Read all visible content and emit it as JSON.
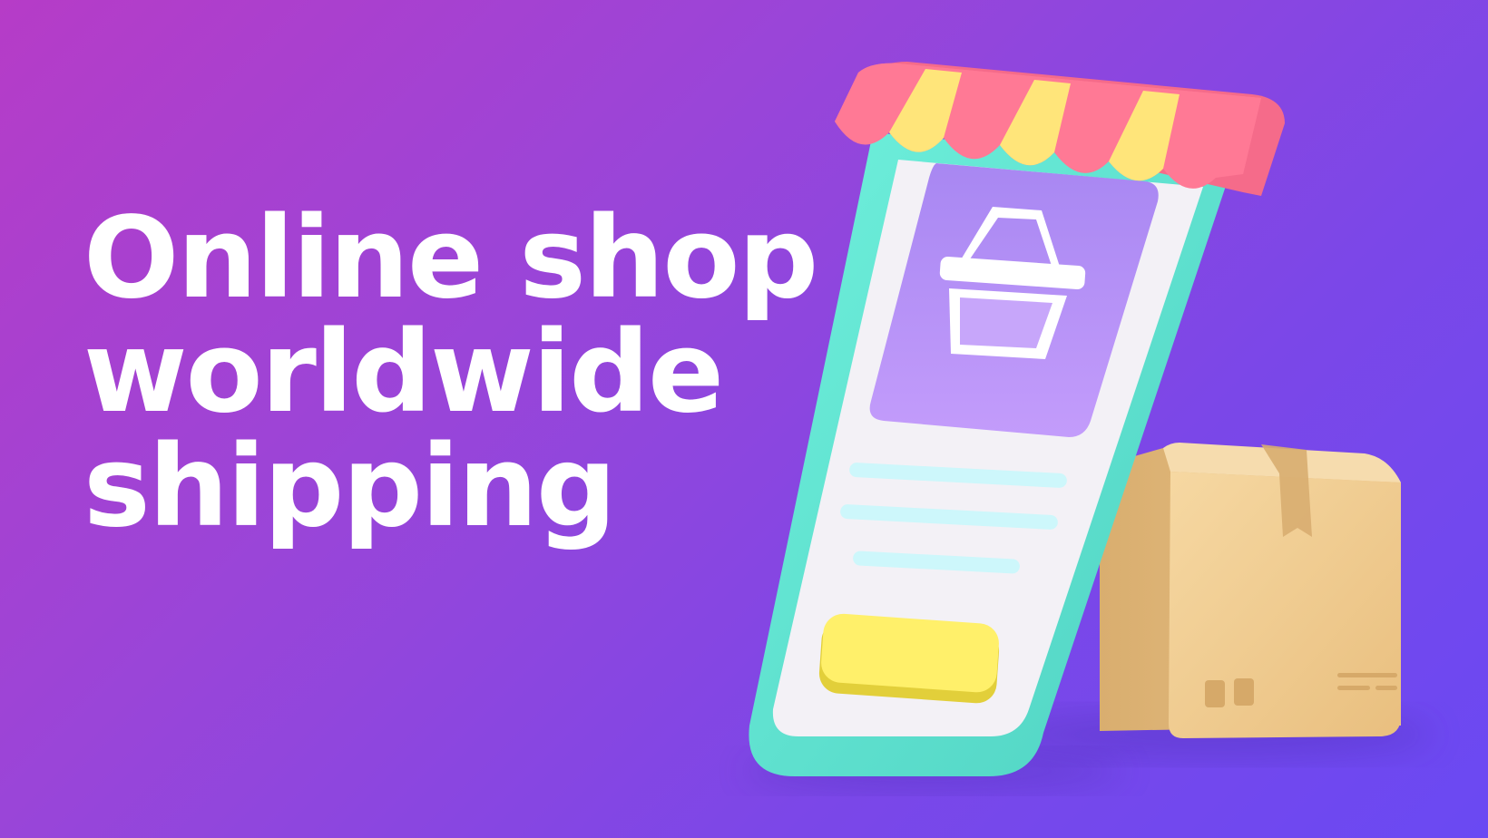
{
  "headline": {
    "lines": [
      "Online shop",
      "worldwide",
      "shipping"
    ]
  },
  "illustration": {
    "objects": [
      "storefront-phone",
      "shopping-basket-icon",
      "text-lines",
      "buy-button",
      "cardboard-box"
    ]
  },
  "colors": {
    "background_start": "#b63cc7",
    "background_end": "#6a49f3",
    "phone_frame": "#5fe3cf",
    "phone_screen": "#f3f1f6",
    "card_purple": "#b18ef7",
    "awning_pink": "#ff6f8f",
    "awning_yellow": "#ffe57a",
    "button_yellow": "#fff06a",
    "text_line_cyan": "#cdf7fb",
    "box_tan": "#f2cf93"
  }
}
